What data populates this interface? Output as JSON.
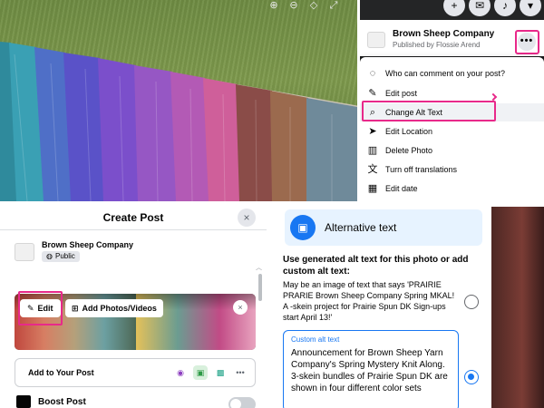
{
  "colors": {
    "highlight": "#e8298a",
    "facebook_blue": "#1877f2",
    "menu_hover": "#f0f2f5",
    "dark_topbar": "#242526"
  },
  "photo_viewer": {
    "icons": [
      "zoom-in-icon",
      "zoom-out-icon",
      "tag-icon",
      "fullscreen-icon"
    ]
  },
  "post_menu": {
    "brand": "Brown Sheep Company",
    "published": "Published by Flossie Arend",
    "topbar_icons": [
      "plus-icon",
      "messenger-icon",
      "bell-icon",
      "caret-down-icon"
    ],
    "more_button": "•••",
    "items": [
      {
        "label": "Who can comment on your post?",
        "icon": "speech-bubble-icon"
      },
      {
        "label": "Edit post",
        "icon": "pencil-icon"
      },
      {
        "label": "Change Alt Text",
        "icon": "search-icon"
      },
      {
        "label": "Edit Location",
        "icon": "location-arrow-icon"
      },
      {
        "label": "Delete Photo",
        "icon": "trash-icon"
      },
      {
        "label": "Turn off translations",
        "icon": "translate-icon"
      },
      {
        "label": "Edit date",
        "icon": "calendar-icon"
      }
    ]
  },
  "create_post": {
    "title": "Create Post",
    "close": "×",
    "brand": "Brown Sheep Company",
    "audience": "Public",
    "edit_label": "Edit",
    "add_media_label": "Add Photos/Videos",
    "add_to_post": "Add to Your Post",
    "boost_label": "Boost Post",
    "add_icons": [
      "tag-people-icon",
      "photo-icon",
      "sticker-icon",
      "more-icon"
    ]
  },
  "alt_text": {
    "title": "Alternative text",
    "question": "Use generated alt text for this photo or add custom alt text:",
    "generated": "May be an image of text that says 'PRAIRIE PRARIE Brown Sheep Company Spring MKAL! A -skein project for Prairie Spun DK Sign-ups start April 13!'",
    "custom_label": "Custom alt text",
    "custom_text": "Announcement for Brown Sheep Yarn Company's Spring Mystery Knit Along. 3-skein bundles of Prairie Spun DK are shown in four different color sets"
  }
}
